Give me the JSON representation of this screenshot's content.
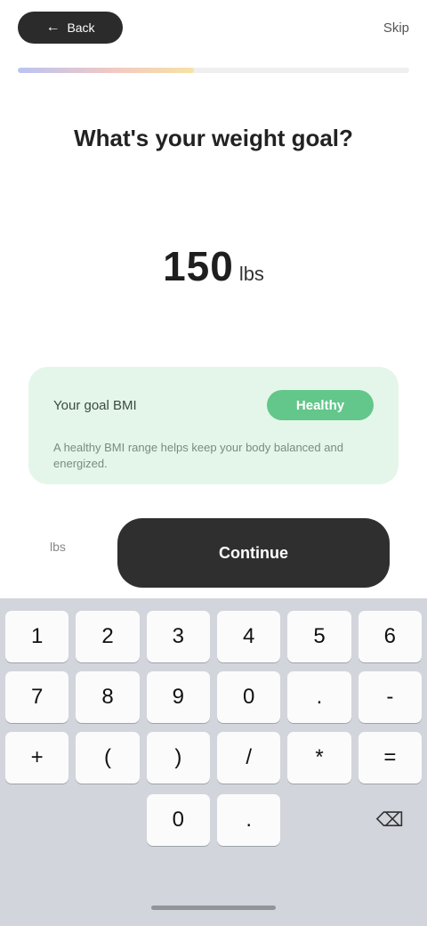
{
  "header": {
    "back_label": "Back",
    "back_icon": "arrow-left-icon",
    "skip_label": "Skip"
  },
  "progress": {
    "fraction": 0.45
  },
  "question": "What's your weight goal?",
  "value": {
    "number": "150",
    "unit": "lbs"
  },
  "bmi_card": {
    "label": "Your goal BMI",
    "badge": "Healthy",
    "description": "A healthy BMI range helps keep your body balanced and energized."
  },
  "unit_hint": "lbs",
  "continue_button": {
    "label": "Continue"
  },
  "keyboard": {
    "rows": [
      [
        "1",
        "2",
        "3",
        "4",
        "5",
        "6"
      ],
      [
        "7",
        "8",
        "9",
        "0",
        ".",
        "-"
      ],
      [
        "+",
        "(",
        ")",
        "/",
        "*",
        "="
      ]
    ],
    "bottom": {
      "zero": "0",
      "dot": ".",
      "delete_icon": "backspace-icon"
    }
  },
  "colors": {
    "primary_dark": "#2f2f2f",
    "card_bg": "#e4f6e9",
    "badge_green": "#63c68a"
  }
}
